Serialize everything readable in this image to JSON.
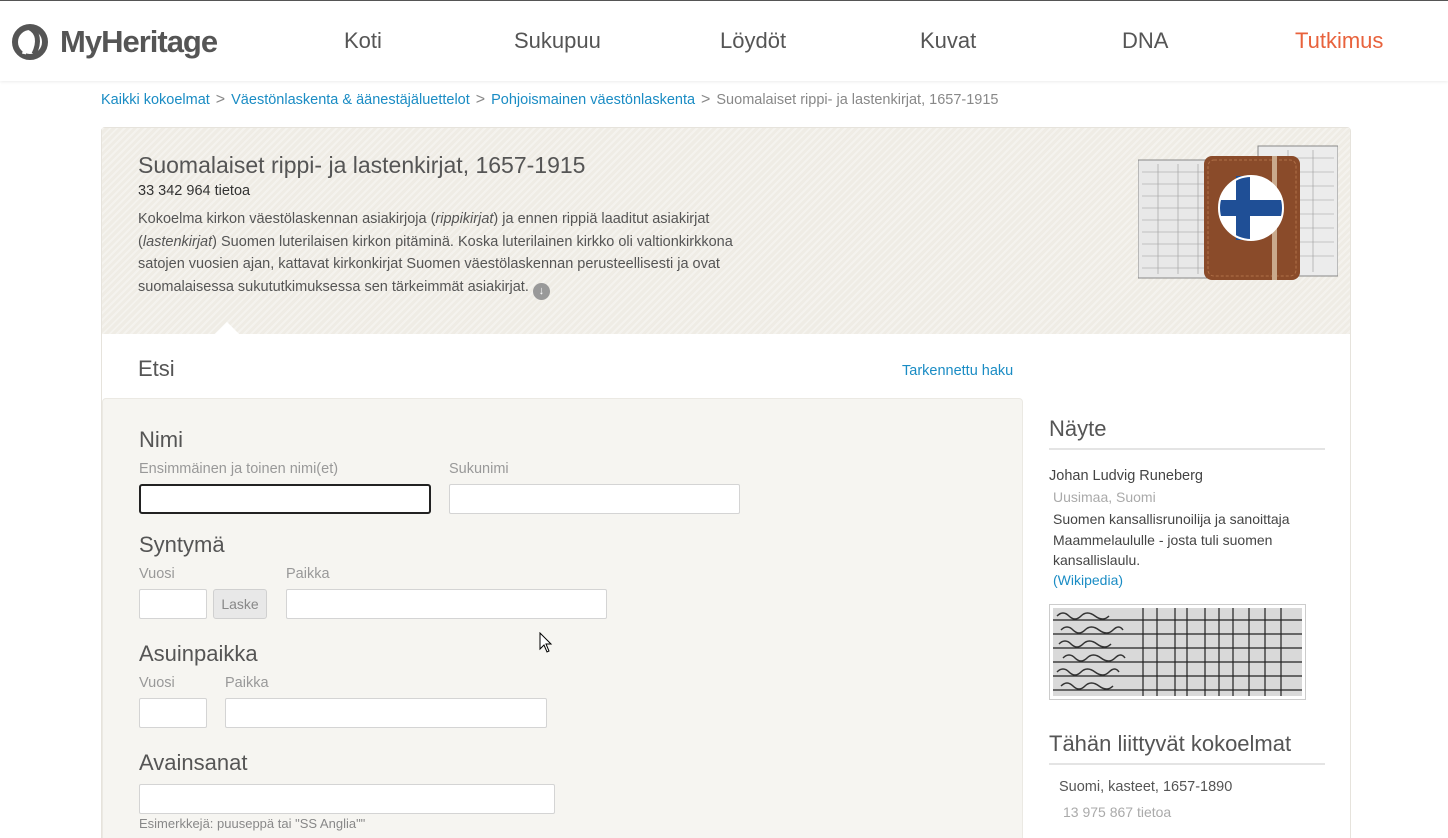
{
  "header": {
    "logo_text": "MyHeritage",
    "nav": [
      {
        "label": "Koti"
      },
      {
        "label": "Sukupuu"
      },
      {
        "label": "Löydöt"
      },
      {
        "label": "Kuvat"
      },
      {
        "label": "DNA"
      },
      {
        "label": "Tutkimus",
        "active": true
      }
    ],
    "accent_color": "#e8623c"
  },
  "breadcrumb": [
    {
      "label": "Kaikki kokoelmat"
    },
    {
      "label": "Väestönlaskenta & äänestäjäluettelot"
    },
    {
      "label": "Pohjoismainen väestönlaskenta"
    },
    {
      "label": "Suomalaiset rippi- ja lastenkirjat, 1657-1915"
    }
  ],
  "collection": {
    "title": "Suomalaiset rippi- ja lastenkirjat, 1657-1915",
    "count": "33 342 964 tietoa",
    "desc_part1": "Kokoelma kirkon väestölaskennan asiakirjoja (",
    "desc_italic1": "rippikirjat",
    "desc_part2": ") ja ennen rippiä laaditut asiakirjat (",
    "desc_italic2": "lastenkirjat",
    "desc_part3": ") Suomen luterilaisen kirkon pitäminä. Koska luterilainen kirkko oli valtionkirkkona satojen vuosien ajan, kattavat kirkonkirjat Suomen väestölaskennan perusteellisesti ja ovat suomalaisessa sukututkimuksessa sen tärkeimmät asiakirjat.",
    "more_icon": "arrow-down-circle-icon"
  },
  "search": {
    "heading": "Etsi",
    "advanced_link": "Tarkennettu haku",
    "name_group": {
      "title": "Nimi",
      "first_label": "Ensimmäinen ja toinen nimi(et)",
      "first_value": "",
      "last_label": "Sukunimi",
      "last_value": ""
    },
    "birth_group": {
      "title": "Syntymä",
      "year_label": "Vuosi",
      "year_value": "",
      "calc_button": "Laske",
      "place_label": "Paikka",
      "place_value": ""
    },
    "residence_group": {
      "title": "Asuinpaikka",
      "year_label": "Vuosi",
      "year_value": "",
      "place_label": "Paikka",
      "place_value": ""
    },
    "keywords_group": {
      "title": "Avainsanat",
      "value": "",
      "hint": "Esimerkkejä: puuseppä tai \"SS Anglia\"\""
    }
  },
  "sidebar": {
    "sample_title": "Näyte",
    "sample_name": "Johan Ludvig Runeberg",
    "sample_place": "Uusimaa, Suomi",
    "sample_desc": "Suomen kansallisrunoilija ja sanoittaja Maammelaululle - josta tuli suomen kansallislaulu.",
    "sample_link": "(Wikipedia)",
    "related_title": "Tähän liittyvät kokoelmat",
    "related": [
      {
        "name": "Suomi, kasteet, 1657-1890",
        "count": "13 975 867 tietoa"
      }
    ]
  }
}
